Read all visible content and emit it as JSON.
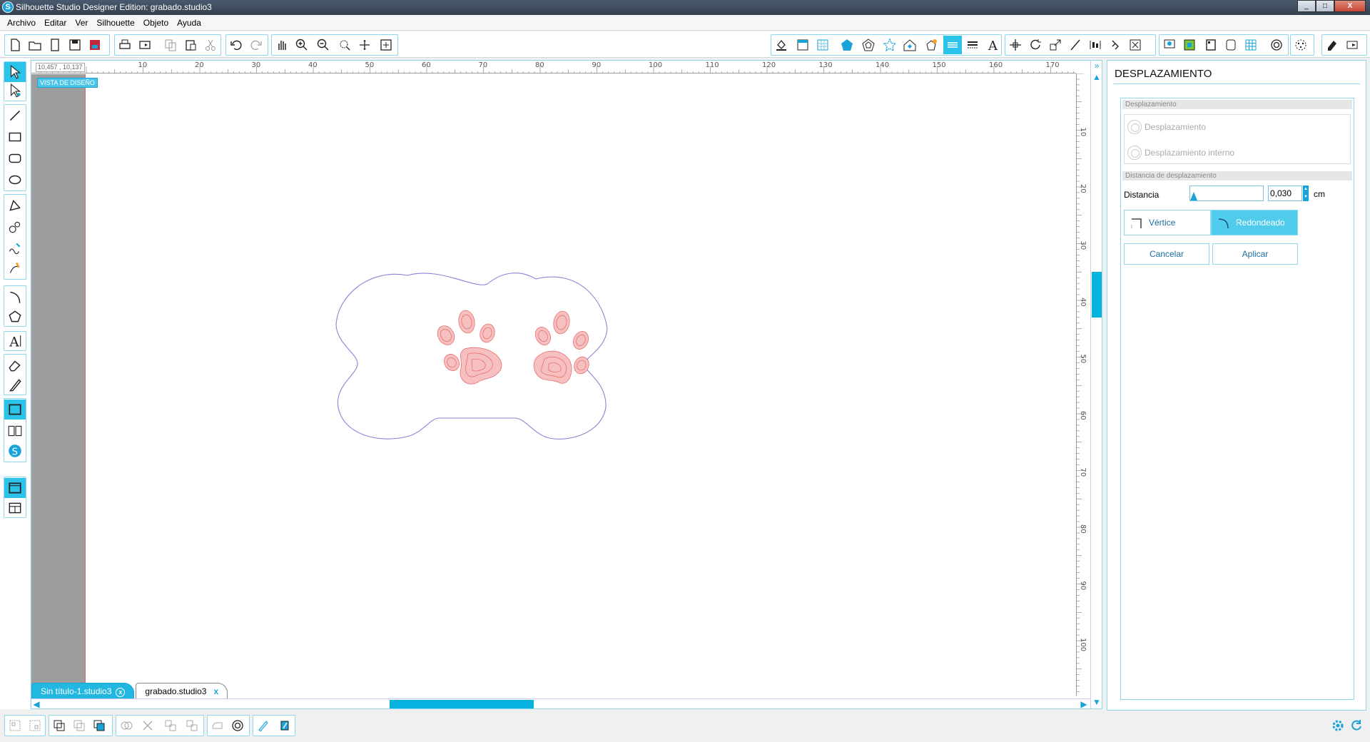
{
  "window": {
    "title": "Silhouette Studio Designer Edition: grabado.studio3",
    "min": "_",
    "max": "□",
    "close": "X"
  },
  "menu": [
    "Archivo",
    "Editar",
    "Ver",
    "Silhouette",
    "Objeto",
    "Ayuda"
  ],
  "canvas": {
    "coords": "10,457 , 10,137",
    "view_label": "VISTA DE DISEÑO",
    "h_ticks": [
      "10",
      "20",
      "30",
      "40",
      "50",
      "60",
      "70",
      "80",
      "90",
      "100",
      "110",
      "120",
      "130",
      "140",
      "150",
      "160",
      "170"
    ],
    "v_ticks": [
      "10",
      "20",
      "30",
      "40",
      "50",
      "60",
      "70",
      "80",
      "90",
      "100"
    ],
    "tabs": [
      {
        "label": "Sin título-1.studio3",
        "close": "x"
      },
      {
        "label": "grabado.studio3",
        "close": "x"
      }
    ]
  },
  "panel": {
    "title": "DESPLAZAMIENTO",
    "section_offset": "Desplazamiento",
    "option_offset": "Desplazamiento",
    "option_internal": "Desplazamiento interno",
    "section_distance": "Distancia de desplazamiento",
    "distance_label": "Distancia",
    "distance_value": "0,030",
    "distance_unit": "cm",
    "corner_vertex": "Vértice",
    "corner_round": "Redondeado",
    "cancel": "Cancelar",
    "apply": "Aplicar"
  },
  "colors": {
    "accent": "#1aa3d9",
    "shape_outline": "#8d82d6",
    "engrave": "#e5706f"
  }
}
